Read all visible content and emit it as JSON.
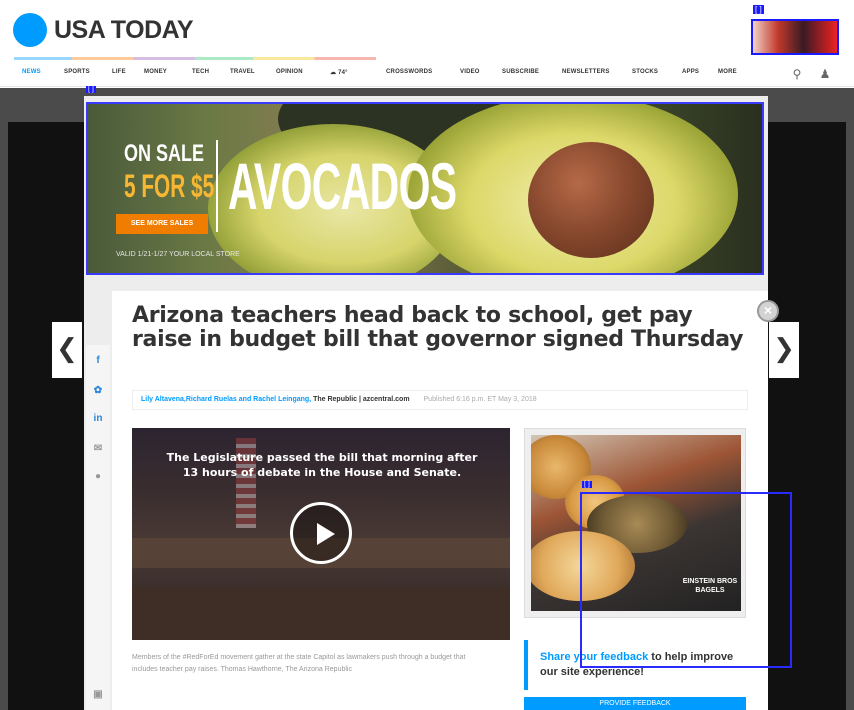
{
  "header": {
    "logo_text": "USA TODAY",
    "brand_color": "#009bff"
  },
  "nav": {
    "items": [
      "NEWS",
      "SPORTS",
      "LIFE",
      "MONEY",
      "TECH",
      "TRAVEL",
      "OPINION",
      "74°",
      "CROSSWORDS",
      "VIDEO",
      "SUBSCRIBE",
      "NEWSLETTERS",
      "STOCKS",
      "APPS",
      "MORE"
    ],
    "active": "NEWS"
  },
  "banner": {
    "on_sale": "ON SALE",
    "price": "5 FOR $5",
    "title": "AVOCADOS",
    "button": "SEE MORE SALES",
    "fine_print": "VALID 1/21-1/27 YOUR LOCAL STORE"
  },
  "article": {
    "headline": "Arizona teachers head back to school, get pay raise in budget bill that governor signed Thursday",
    "authors": "Lily Altavena,Richard Ruelas and Rachel Leingang,",
    "source": "The Republic | azcentral.com",
    "published": "Published 6:16 p.m. ET May 3, 2018"
  },
  "video": {
    "caption": "The Legislature passed the bill that morning after 13 hours of debate in the House and Senate.",
    "description": "Members of the #RedForEd movement gather at the state Capitol as lawmakers push through a budget that includes teacher pay raises. Thomas Hawthorne, The Arizona Republic"
  },
  "side_ad": {
    "brand": "EINSTEIN BROS BAGELS"
  },
  "feedback": {
    "link": "Share your feedback",
    "rest": " to help improve our site experience!",
    "button": "PROVIDE FEEDBACK"
  },
  "icons": [
    "search-icon",
    "user-icon",
    "close-icon",
    "chevron-left-icon",
    "chevron-right-icon",
    "facebook-icon",
    "twitter-icon",
    "linkedin-icon",
    "email-icon",
    "comment-icon",
    "play-icon"
  ]
}
